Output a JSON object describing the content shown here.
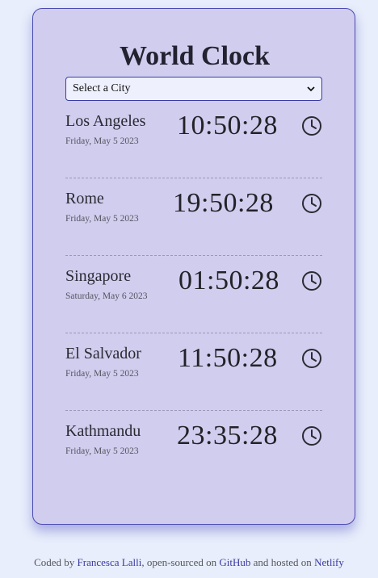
{
  "app": {
    "title": "World Clock"
  },
  "city_select": {
    "selected": "Select a City"
  },
  "cities": [
    {
      "name": "Los Angeles",
      "date": "Friday, May 5 2023",
      "time": "10:50:28"
    },
    {
      "name": "Rome",
      "date": "Friday, May 5 2023",
      "time": "19:50:28"
    },
    {
      "name": "Singapore",
      "date": "Saturday, May 6 2023",
      "time": "01:50:28"
    },
    {
      "name": "El Salvador",
      "date": "Friday, May 5 2023",
      "time": "11:50:28"
    },
    {
      "name": "Kathmandu",
      "date": "Friday, May 5 2023",
      "time": "23:35:28"
    }
  ],
  "footer": {
    "text1": "Coded by ",
    "author": "Francesca Lalli",
    "text2": ", open-sourced on ",
    "repo": "GitHub",
    "text3": " and hosted on ",
    "host": "Netlify"
  },
  "colors": {
    "background": "#e8eefb",
    "card": "#d1cdee",
    "card_border": "#4a4ab0",
    "link": "#3a3aa0"
  },
  "icons": {
    "row_icon": "clock-icon",
    "select_icon": "chevron-down-icon"
  }
}
